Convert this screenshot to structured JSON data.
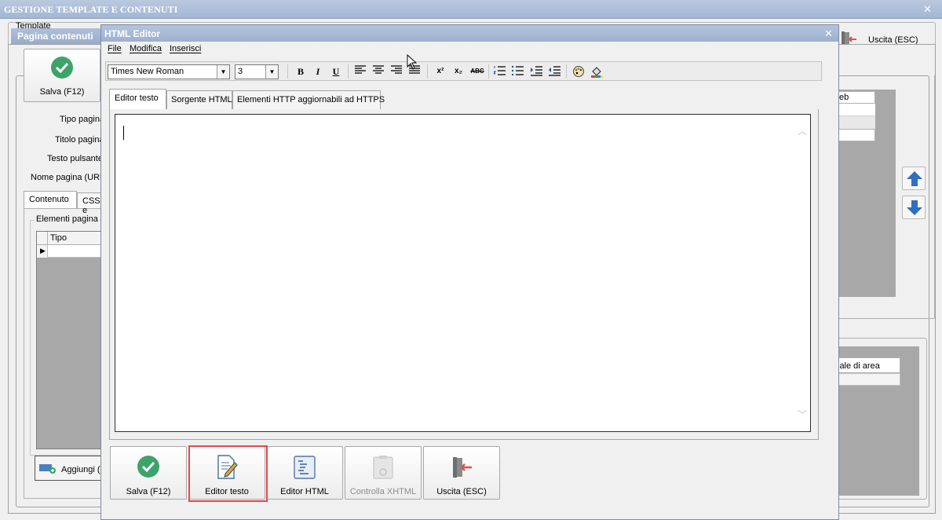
{
  "main_window": {
    "title": "GESTIONE TEMPLATE E CONTENUTI",
    "template_label": "Template",
    "exit_button": "Uscita (ESC)"
  },
  "page_dialog": {
    "title": "Pagina contenuti",
    "save_button": "Salva (F12)",
    "fields": {
      "tipo_pagina": "Tipo pagina",
      "titolo_pagina": "Titolo pagina",
      "testo_pulsante": "Testo pulsante",
      "nome_pagina": "Nome pagina (URL"
    },
    "tabs": [
      "Contenuto",
      "CSS e"
    ],
    "group_label": "Elementi pagina",
    "grid_header": "Tipo",
    "add_button": "Aggiungi (I",
    "right_grid_header": "eb",
    "right_grid2_header": "iale di area"
  },
  "html_editor": {
    "title": "HTML Editor",
    "menu": [
      "File",
      "Modifica",
      "Inserisci"
    ],
    "toolbar": {
      "font": "Times New Roman",
      "size": "3",
      "bold": "B",
      "italic": "I",
      "underline": "U",
      "superscript": "x²",
      "subscript": "x₂",
      "strikethrough": "ABC"
    },
    "tabs": [
      "Editor testo",
      "Sorgente HTML",
      "Elementi HTTP aggiornabili ad HTTPS"
    ],
    "editor_content": "",
    "buttons": {
      "save": "Salva (F12)",
      "text_editor": "Editor testo",
      "html_editor": "Editor HTML",
      "check_xhtml": "Controlla XHTML",
      "exit": "Uscita (ESC)"
    }
  },
  "colors": {
    "title_bar": "#a3b6d3",
    "accent_green": "#3ea36b",
    "arrow_blue": "#2f6fbf",
    "highlight_red": "#e8474c"
  }
}
